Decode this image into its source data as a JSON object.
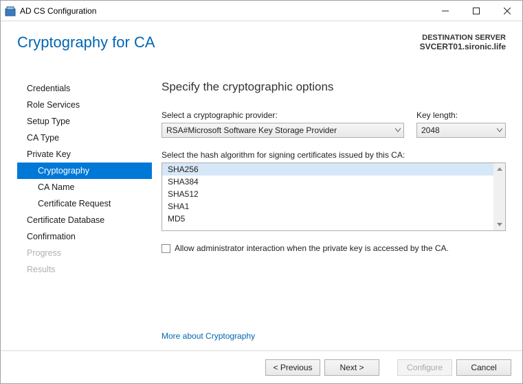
{
  "window": {
    "title": "AD CS Configuration"
  },
  "header": {
    "page_title": "Cryptography for CA",
    "dest_label": "DESTINATION SERVER",
    "dest_server": "SVCERT01.sironic.life"
  },
  "sidebar": {
    "items": [
      {
        "label": "Credentials",
        "state": "normal"
      },
      {
        "label": "Role Services",
        "state": "normal"
      },
      {
        "label": "Setup Type",
        "state": "normal"
      },
      {
        "label": "CA Type",
        "state": "normal"
      },
      {
        "label": "Private Key",
        "state": "normal"
      },
      {
        "label": "Cryptography",
        "state": "selected",
        "sub": true
      },
      {
        "label": "CA Name",
        "state": "normal",
        "sub": true
      },
      {
        "label": "Certificate Request",
        "state": "normal",
        "sub": true
      },
      {
        "label": "Certificate Database",
        "state": "normal"
      },
      {
        "label": "Confirmation",
        "state": "normal"
      },
      {
        "label": "Progress",
        "state": "disabled"
      },
      {
        "label": "Results",
        "state": "disabled"
      }
    ]
  },
  "main": {
    "section_title": "Specify the cryptographic options",
    "provider_label": "Select a cryptographic provider:",
    "provider_value": "RSA#Microsoft Software Key Storage Provider",
    "keylen_label": "Key length:",
    "keylen_value": "2048",
    "hash_label": "Select the hash algorithm for signing certificates issued by this CA:",
    "hash_options": [
      "SHA256",
      "SHA384",
      "SHA512",
      "SHA1",
      "MD5"
    ],
    "hash_selected_index": 0,
    "checkbox_label": "Allow administrator interaction when the private key is accessed by the CA.",
    "checkbox_checked": false,
    "more_link": "More about Cryptography"
  },
  "footer": {
    "previous": "< Previous",
    "next": "Next >",
    "configure": "Configure",
    "cancel": "Cancel"
  }
}
